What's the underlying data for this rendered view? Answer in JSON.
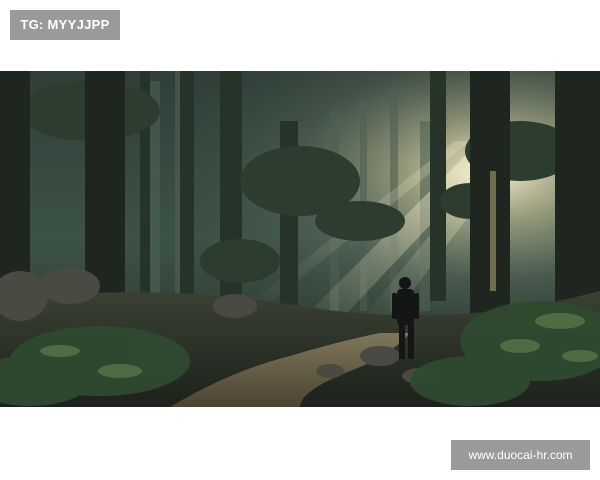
{
  "watermark_top": "TG: MYYJJPP",
  "watermark_bottom": "www.duocai-hr.com",
  "colors": {
    "label_background": "#9a9a9a",
    "label_text": "#ffffff",
    "page_background": "#ffffff"
  }
}
